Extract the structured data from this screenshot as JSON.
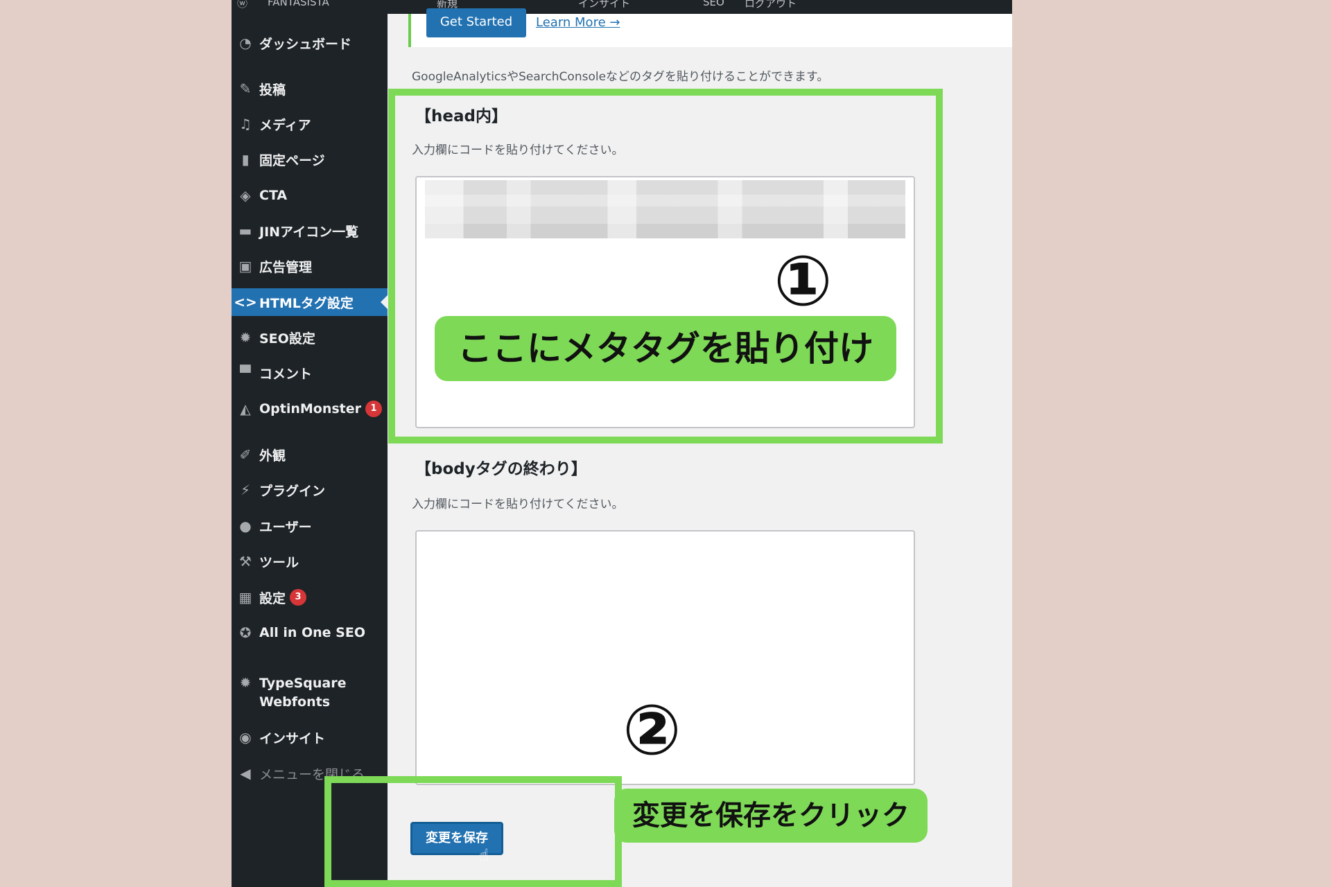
{
  "admin_bar": {
    "site_name": "FANTASISTA",
    "new_label": "新規",
    "insight_label": "インサイト",
    "seo_label": "SEO",
    "logout_label": "ログアウト"
  },
  "sidebar": {
    "items": [
      {
        "label": "ダッシュボード",
        "icon": "dashboard-icon"
      },
      {
        "label": "投稿",
        "icon": "pin-icon"
      },
      {
        "label": "メディア",
        "icon": "media-icon"
      },
      {
        "label": "固定ページ",
        "icon": "page-icon"
      },
      {
        "label": "CTA",
        "icon": "tag-icon"
      },
      {
        "label": "JINアイコン一覧",
        "icon": "list-icon"
      },
      {
        "label": "広告管理",
        "icon": "ad-icon"
      },
      {
        "label": "HTMLタグ設定",
        "icon": "code-icon"
      },
      {
        "label": "SEO設定",
        "icon": "gear-icon"
      },
      {
        "label": "コメント",
        "icon": "comment-icon"
      },
      {
        "label": "OptinMonster",
        "icon": "monster-icon",
        "badge": "1"
      },
      {
        "label": "外観",
        "icon": "brush-icon"
      },
      {
        "label": "プラグイン",
        "icon": "plugin-icon"
      },
      {
        "label": "ユーザー",
        "icon": "user-icon"
      },
      {
        "label": "ツール",
        "icon": "wrench-icon"
      },
      {
        "label": "設定",
        "icon": "settings-icon",
        "badge": "3"
      },
      {
        "label": "All in One SEO",
        "icon": "aioseo-icon"
      },
      {
        "label": "TypeSquare",
        "label2": "Webfonts",
        "icon": "gear-icon"
      },
      {
        "label": "インサイト",
        "icon": "insight-icon"
      },
      {
        "label": "メニューを閉じる",
        "icon": "collapse-icon"
      }
    ]
  },
  "notice": {
    "get_started": "Get Started",
    "learn_more": "Learn More →"
  },
  "description": "GoogleAnalyticsやSearchConsoleなどのタグを貼り付けることができます。",
  "head_section": {
    "title": "【head内】",
    "hint": "入力欄にコードを貼り付けてください。"
  },
  "body_section": {
    "title": "【bodyタグの終わり】",
    "hint": "入力欄にコードを貼り付けてください。"
  },
  "save_button": "変更を保存",
  "annotations": {
    "step1_number": "①",
    "step1_text": "ここにメタタグを貼り付け",
    "step2_number": "②",
    "step2_text": "変更を保存をクリック",
    "highlight_color": "#7ed957"
  },
  "colors": {
    "sidebar_bg": "#1d2327",
    "active_item": "#2271b1",
    "badge": "#d63638"
  }
}
